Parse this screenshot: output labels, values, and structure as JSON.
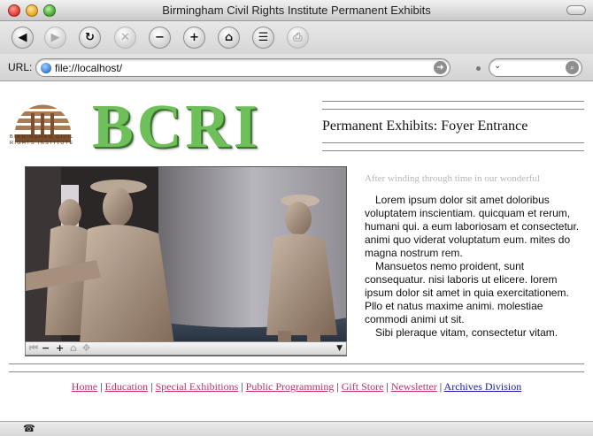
{
  "window": {
    "title": "Birmingham Civil Rights Institute Permanent Exhibits"
  },
  "toolbar": {
    "buttons": [
      {
        "name": "back",
        "glyph": "◀"
      },
      {
        "name": "forward",
        "glyph": "▶"
      },
      {
        "name": "reload",
        "glyph": "↻"
      },
      {
        "name": "stop",
        "glyph": "✕"
      },
      {
        "name": "text-smaller",
        "glyph": "−"
      },
      {
        "name": "text-larger",
        "glyph": "+"
      },
      {
        "name": "home",
        "glyph": "⌂"
      },
      {
        "name": "autofill",
        "glyph": "☰"
      },
      {
        "name": "print",
        "glyph": "⎙"
      }
    ]
  },
  "urlbar": {
    "label": "URL:",
    "value": "file://localhost/"
  },
  "page": {
    "logo_text": "BIRMINGHAM CIVIL RIGHTS INSTITUTE",
    "brand": "BCRI",
    "title": "Permanent Exhibits: Foyer Entrance",
    "intro_faded": "After winding through time in our wonderful",
    "lorem_paragraphs": [
      "Lorem ipsum dolor sit amet doloribus voluptatem inscientiam. quicquam et rerum, humani qui. a eum laboriosam et consectetur. animi quo viderat voluptatum eum. mites do magna nostrum rem.",
      "Mansuetos nemo proident, sunt consequatur. nisi laboris ut elicere. lorem ipsum dolor sit amet in quia exercitationem. Pllo et natus maxime animi. molestiae commodi animi ut sit.",
      "Sibi pleraque vitam, consectetur vitam."
    ],
    "video_controls": {
      "minus": "−",
      "plus": "+",
      "menu": "▼"
    }
  },
  "nav": {
    "links": [
      "Home",
      "Education",
      "Special Exhibitions",
      "Public Programming",
      "Gift Store",
      "Newsletter",
      "Archives Division"
    ],
    "separator": " | "
  },
  "colors": {
    "brand_green": "#6fbf5a",
    "link_color": "#c0306a",
    "visited_link_color": "#1a1ab0"
  }
}
